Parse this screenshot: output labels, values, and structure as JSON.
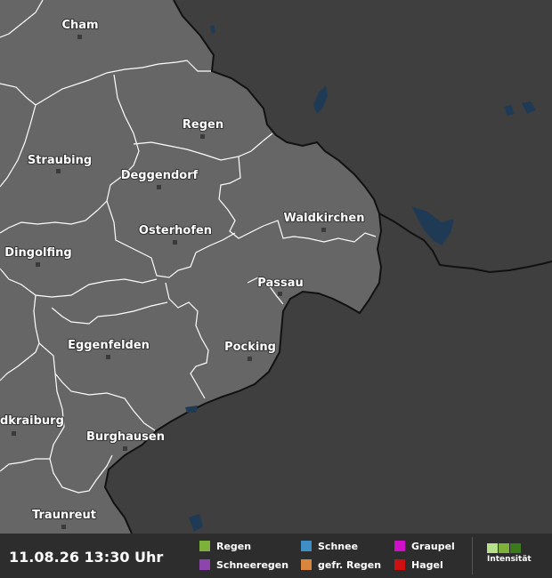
{
  "map": {
    "cities": [
      {
        "name": "Cham"
      },
      {
        "name": "Regen"
      },
      {
        "name": "Straubing"
      },
      {
        "name": "Deggendorf"
      },
      {
        "name": "Waldkirchen"
      },
      {
        "name": "Osterhofen"
      },
      {
        "name": "Dingolfing"
      },
      {
        "name": "Passau"
      },
      {
        "name": "Eggenfelden"
      },
      {
        "name": "Pocking"
      },
      {
        "name": "dkraiburg"
      },
      {
        "name": "Burghausen"
      },
      {
        "name": "Traunreut"
      }
    ]
  },
  "footer": {
    "timestamp": "11.08.26 13:30 Uhr",
    "legend": [
      {
        "label": "Regen",
        "color": "#7db13a"
      },
      {
        "label": "Schneeregen",
        "color": "#8e44ad"
      },
      {
        "label": "Schnee",
        "color": "#3d8fc6"
      },
      {
        "label": "gefr. Regen",
        "color": "#d9853b"
      },
      {
        "label": "Graupel",
        "color": "#d010c8"
      },
      {
        "label": "Hagel",
        "color": "#d01010"
      }
    ],
    "intensity_label": "Intensität",
    "intensity_colors": [
      "#b6e08a",
      "#7db13a",
      "#3b7a1a"
    ]
  }
}
